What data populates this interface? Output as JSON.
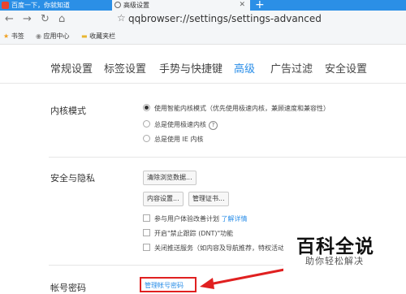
{
  "tabs": [
    {
      "label": "百度一下，你就知道"
    },
    {
      "label": "高级设置"
    }
  ],
  "address": {
    "url": "qqbrowser://settings/settings-advanced"
  },
  "bookmarks": [
    {
      "label": "书签"
    },
    {
      "label": "应用中心"
    },
    {
      "label": "收藏夹栏"
    }
  ],
  "nav": {
    "items": [
      {
        "label": "常规设置"
      },
      {
        "label": "标签设置"
      },
      {
        "label": "手势与快捷键"
      },
      {
        "label": "高级"
      },
      {
        "label": "广告过滤"
      },
      {
        "label": "安全设置"
      }
    ],
    "active_index": 3
  },
  "kernel": {
    "title": "内核模式",
    "options": [
      {
        "label": "使用智能内核模式（优先使用极速内核，兼顾速度和兼容性）",
        "checked": true
      },
      {
        "label": "总是使用极速内核",
        "checked": false
      },
      {
        "label": "总是使用 IE 内核",
        "checked": false
      }
    ]
  },
  "security": {
    "title": "安全与隐私",
    "clear_button": "清除浏览数据...",
    "content_button": "内容设置...",
    "cert_button": "管理证书...",
    "checkboxes": [
      {
        "label": "参与用户体验改善计划",
        "link": "了解详情"
      },
      {
        "label": "开启\"禁止跟踪 (DNT)\"功能"
      },
      {
        "label": "关闭推送服务（如内容及导航推荐，特权活动等"
      }
    ]
  },
  "password": {
    "title": "帐号密码",
    "manage_link": "管理帐号密码"
  },
  "watermark": {
    "title": "百科全说",
    "subtitle": "助你轻松解决"
  },
  "colors": {
    "accent": "#2a8ee8",
    "tabbar": "#2b8fe6",
    "highlight": "#e02020"
  }
}
